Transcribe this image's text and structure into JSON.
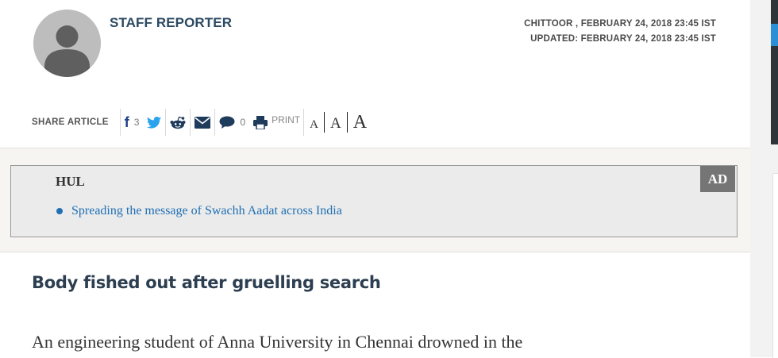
{
  "author": {
    "name": "STAFF REPORTER"
  },
  "meta": {
    "dateline": "CHITTOOR , FEBRUARY 24, 2018 23:45 IST",
    "updated": "UPDATED: FEBRUARY 24, 2018 23:45 IST"
  },
  "share": {
    "label": "SHARE ARTICLE",
    "facebook_count": "3",
    "comment_count": "0",
    "print_label": "PRINT",
    "font_sizes": [
      "A",
      "A",
      "A"
    ]
  },
  "ad": {
    "sponsor": "HUL",
    "badge": "AD",
    "link_text": "Spreading the message of Swachh Aadat across India",
    "link_color": "#1f6fb4"
  },
  "article": {
    "headline": "Body fished out after gruelling search",
    "body_first_line": "An engineering student of Anna University in Chennai drowned in the"
  },
  "icons": [
    "facebook-icon",
    "twitter-icon",
    "reddit-icon",
    "email-icon",
    "comment-icon",
    "print-icon"
  ]
}
